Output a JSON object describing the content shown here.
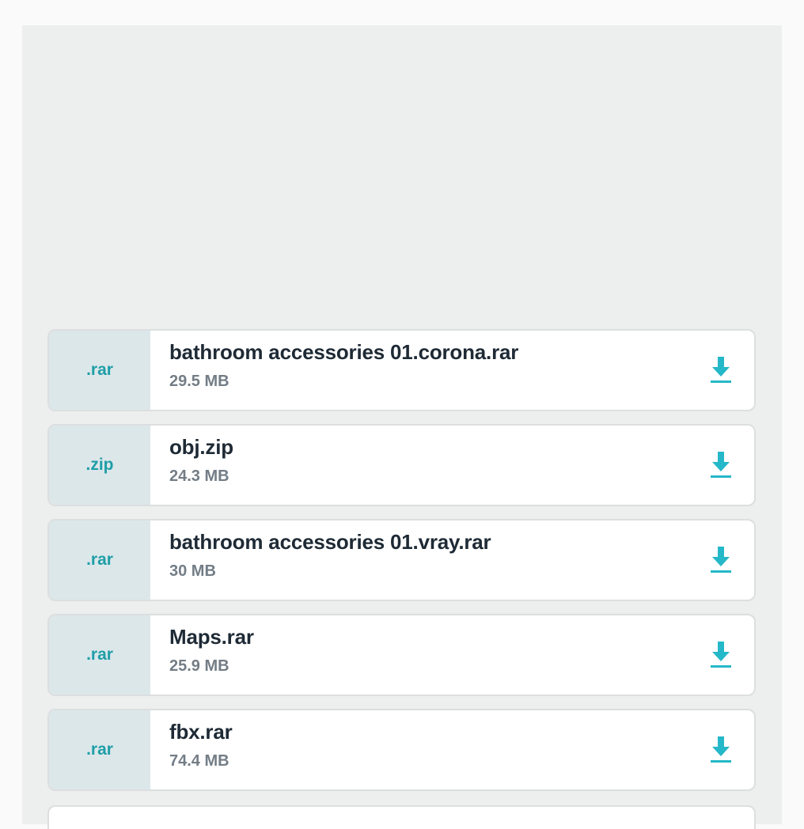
{
  "colors": {
    "page_bg": "#fafafa",
    "panel_bg": "#edefee",
    "card_bg": "#ffffff",
    "ext_bg": "#dce7ea",
    "accent": "#1f9ea7",
    "download_icon": "#25b8c8",
    "title_text": "#1e2a35",
    "size_text": "#737d86"
  },
  "files": [
    {
      "extension": ".rar",
      "name": "bathroom accessories 01.corona.rar",
      "size": "29.5 MB",
      "icon": "download-icon"
    },
    {
      "extension": ".zip",
      "name": "obj.zip",
      "size": "24.3 MB",
      "icon": "download-icon"
    },
    {
      "extension": ".rar",
      "name": "bathroom accessories 01.vray.rar",
      "size": "30 MB",
      "icon": "download-icon"
    },
    {
      "extension": ".rar",
      "name": "Maps.rar",
      "size": "25.9 MB",
      "icon": "download-icon"
    },
    {
      "extension": ".rar",
      "name": "fbx.rar",
      "size": "74.4 MB",
      "icon": "download-icon"
    }
  ]
}
